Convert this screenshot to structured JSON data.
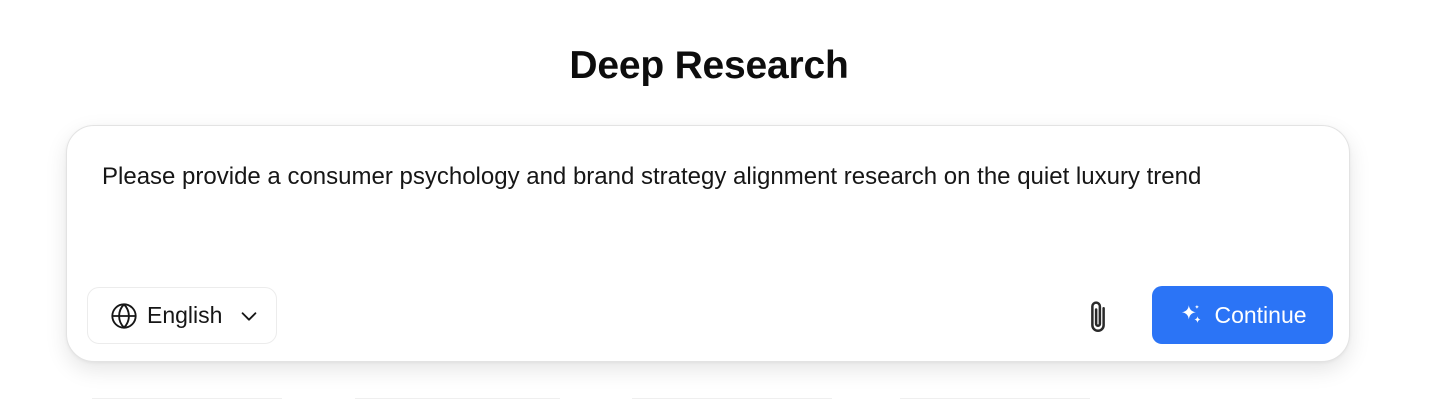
{
  "page": {
    "title": "Deep Research"
  },
  "composer": {
    "prompt_value": "Please provide a consumer psychology and brand strategy alignment research on the quiet luxury trend",
    "language": {
      "icon": "globe-icon",
      "selected": "English",
      "chevron_icon": "chevron-down-icon"
    },
    "attach_icon": "paperclip-icon",
    "submit": {
      "icon": "sparkle-icon",
      "label": "Continue"
    }
  },
  "colors": {
    "accent": "#2b74f6",
    "text": "#161616",
    "border": "#e3e3e3"
  }
}
